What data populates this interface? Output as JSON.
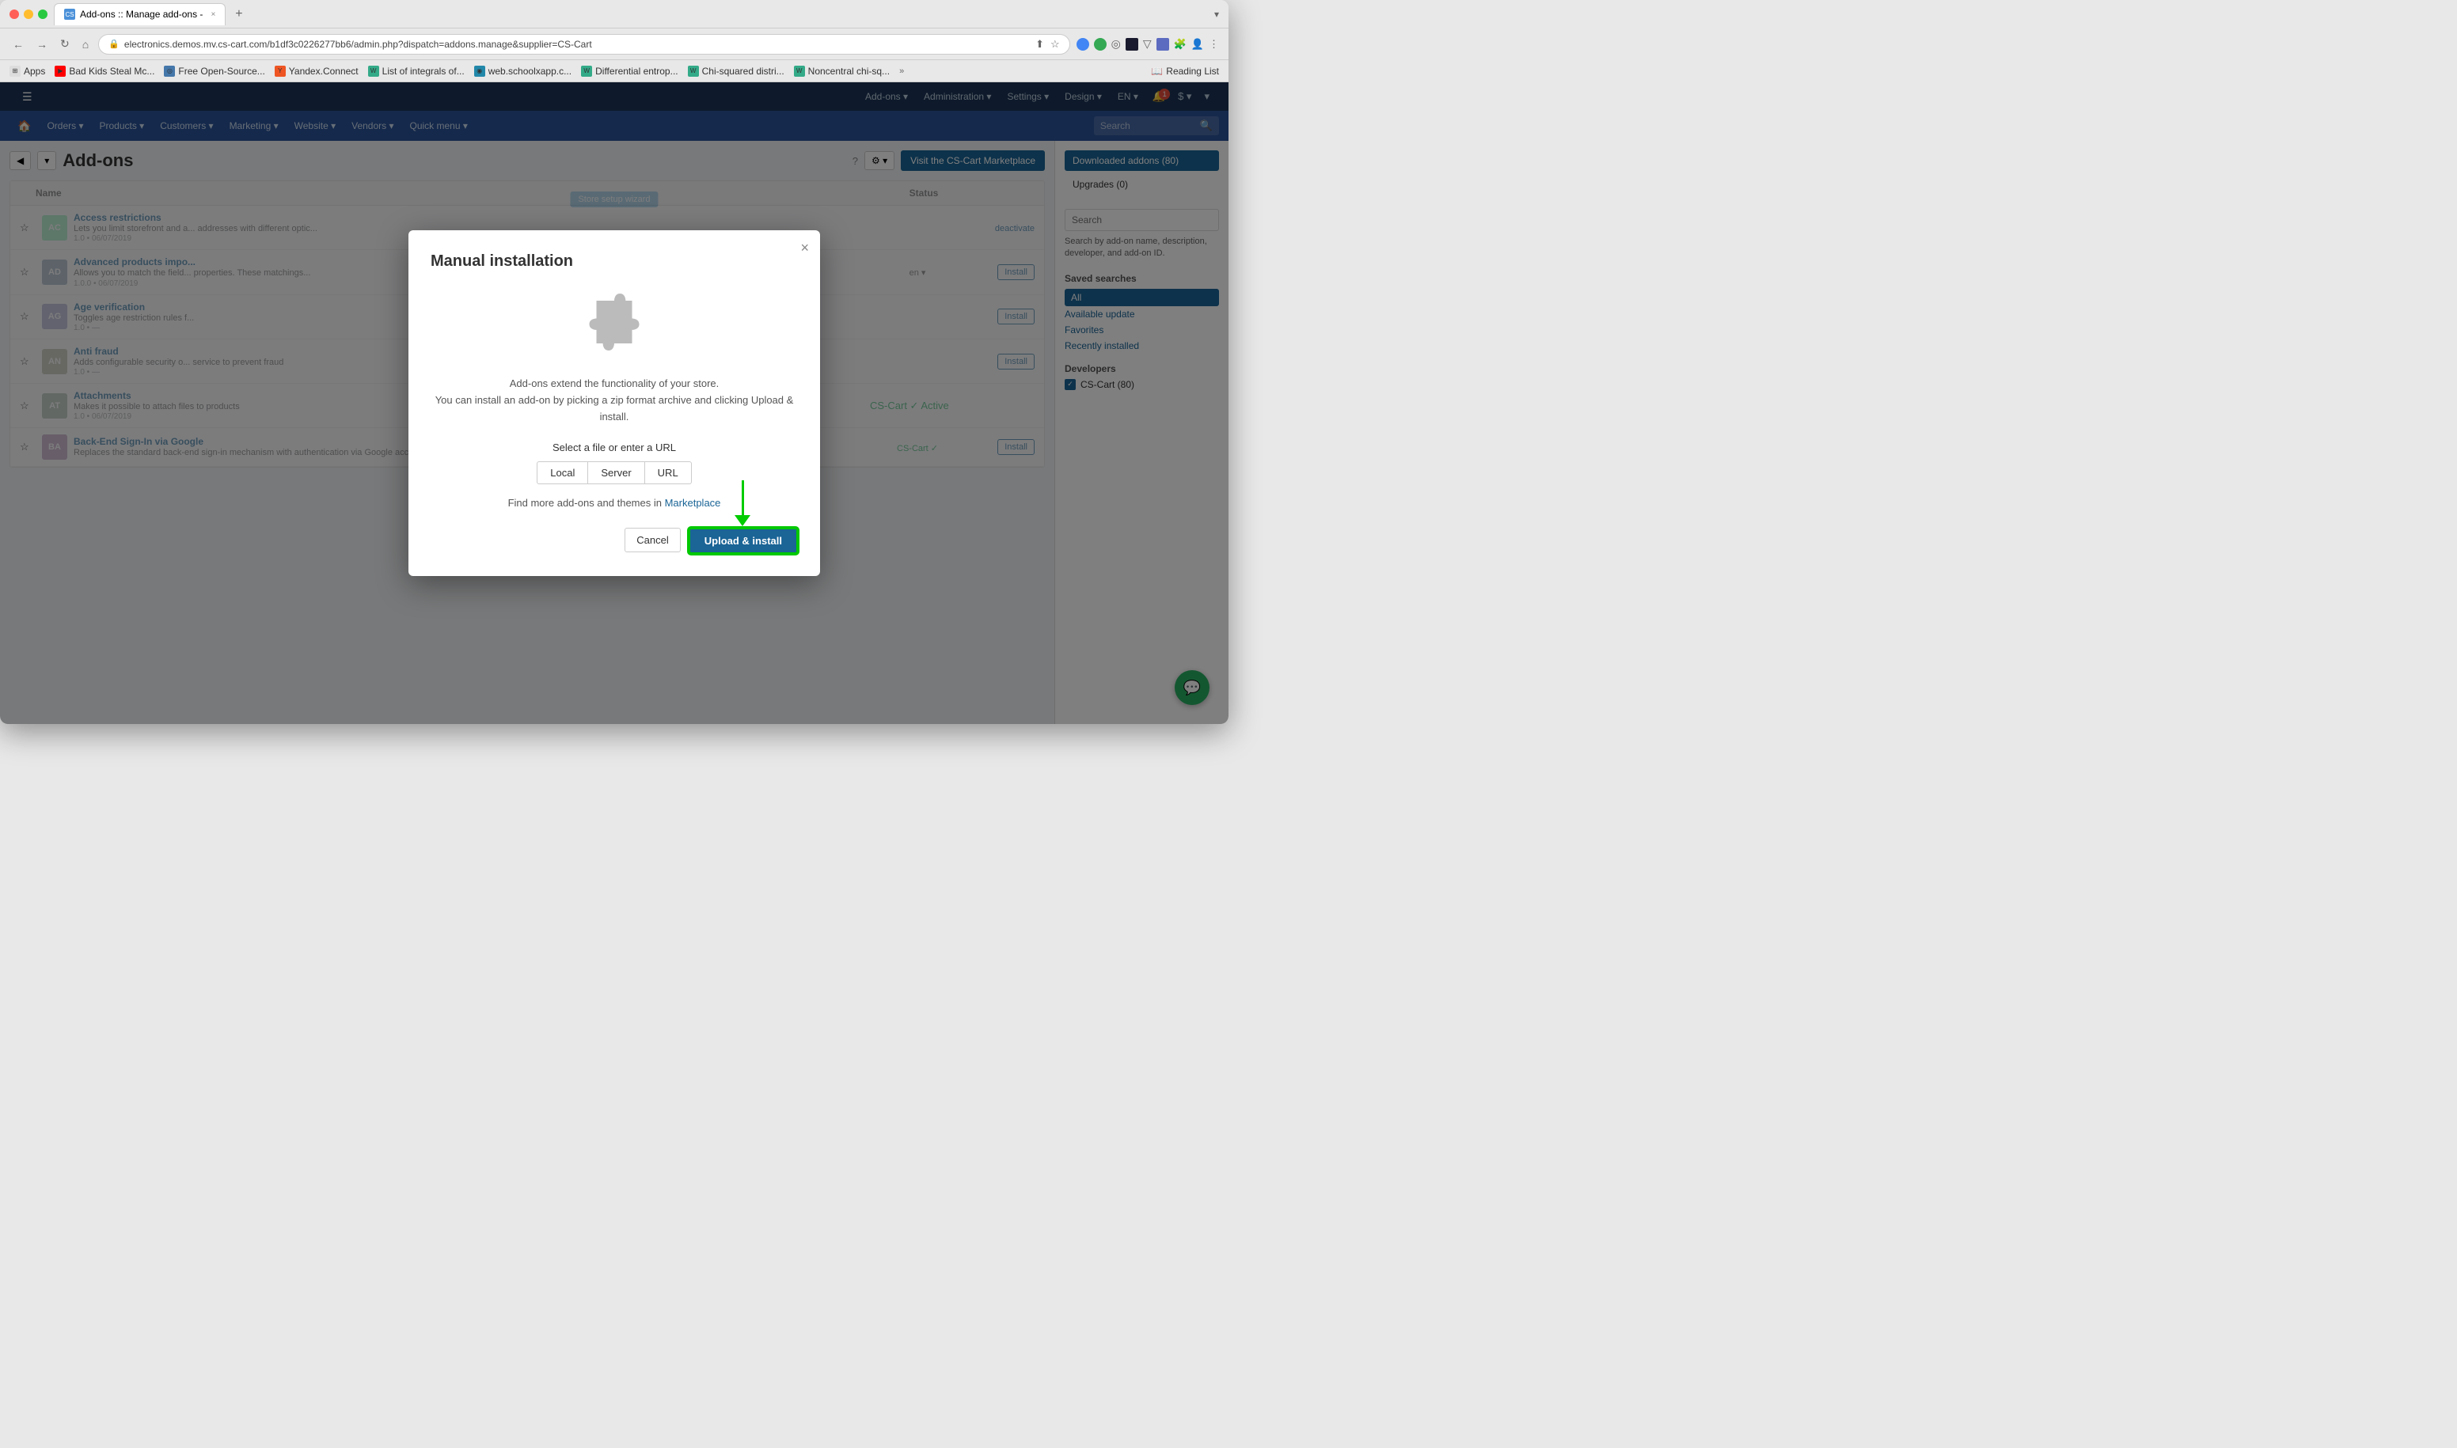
{
  "browser": {
    "tab_label": "Add-ons :: Manage add-ons -",
    "tab_close": "×",
    "tab_add": "+",
    "address": "electronics.demos.mv.cs-cart.com/b1df3c0226277bb6/admin.php?dispatch=addons.manage&supplier=CS-Cart",
    "collapse_icon": "▾",
    "bookmarks": [
      {
        "label": "Apps",
        "icon": "⊞"
      },
      {
        "label": "Bad Kids Steal Mc...",
        "icon": "▶"
      },
      {
        "label": "Free Open-Source...",
        "icon": "◎"
      },
      {
        "label": "Yandex.Connect",
        "icon": "Y"
      },
      {
        "label": "List of integrals of...",
        "icon": "W"
      },
      {
        "label": "web.schoolxapp.c...",
        "icon": "◉"
      },
      {
        "label": "Differential entrop...",
        "icon": "W"
      },
      {
        "label": "Chi-squared distri...",
        "icon": "W"
      },
      {
        "label": "Noncentral chi-sq...",
        "icon": "W"
      },
      {
        "label": "»",
        "icon": ""
      }
    ],
    "reading_list": "Reading List"
  },
  "topnav": {
    "setup_wizard": "Store setup wizard",
    "items": [
      "Add-ons ▾",
      "Administration ▾",
      "Settings ▾",
      "Design ▾",
      "EN ▾"
    ],
    "notification_count": "1",
    "currency": "$ ▾",
    "user": "▾"
  },
  "subnav": {
    "items": [
      "Orders ▾",
      "Products ▾",
      "Customers ▾",
      "Marketing ▾",
      "Website ▾",
      "Vendors ▾"
    ],
    "quick_menu": "Quick menu ▾",
    "search_placeholder": "Search"
  },
  "page": {
    "title": "Add-ons",
    "back_btn": "◀",
    "marketplace_btn": "Visit the CS-Cart Marketplace",
    "table": {
      "col_name": "Name",
      "col_status": "Status",
      "rows": [
        {
          "initials": "AC",
          "name": "Access restrictions",
          "desc": "Lets you limit storefront and a... addresses with different optic...",
          "meta": "1.0 • 06/07/2019",
          "status": "",
          "action": "deactivate",
          "bg": "addon-ac"
        },
        {
          "initials": "AD",
          "name": "Advanced products impo...",
          "desc": "Allows you to match the field... properties. These matchings... saved as presets for later use",
          "meta": "1.0.0 • 06/07/2019",
          "status": "en ▾",
          "action": "install",
          "bg": "addon-ad"
        },
        {
          "initials": "AG",
          "name": "Age verification",
          "desc": "Toggles age restriction rules f...",
          "meta": "1.0 • —",
          "status": "",
          "action": "install",
          "bg": "addon-ag"
        },
        {
          "initials": "AN",
          "name": "Anti fraud",
          "desc": "Adds configurable security o... service to prevent fraud",
          "meta": "1.0 • —",
          "status": "",
          "action": "install",
          "bg": "addon-an"
        },
        {
          "initials": "AT",
          "name": "Attachments",
          "desc": "Makes it possible to attach files to products",
          "meta": "1.0 • 06/07/2019",
          "status": "Active",
          "action": "active",
          "bg": "addon-at"
        },
        {
          "initials": "BA",
          "name": "Back-End Sign-In via Google",
          "desc": "Replaces the standard back-end sign-in mechanism with authentication via Google accounts.",
          "meta": "",
          "status": "CS-Cart ✓",
          "action": "install",
          "bg": "addon-ba"
        }
      ]
    }
  },
  "sidebar": {
    "downloaded_label": "Downloaded addons (80)",
    "upgrades_label": "Upgrades (0)",
    "search_placeholder": "Search",
    "search_desc": "Search by add-on name, description, developer, and add-on ID.",
    "saved_searches_title": "Saved searches",
    "saved_items": [
      {
        "label": "All",
        "active": true
      },
      {
        "label": "Available update",
        "active": false
      },
      {
        "label": "Favorites",
        "active": false
      },
      {
        "label": "Recently installed",
        "active": false
      }
    ],
    "developers_title": "Developers",
    "developers": [
      {
        "label": "CS-Cart (80)",
        "checked": true
      }
    ]
  },
  "modal": {
    "title": "Manual installation",
    "close": "×",
    "desc_line1": "Add-ons extend the functionality of your store.",
    "desc_line2": "You can install an add-on by picking a zip format archive and clicking Upload & install.",
    "file_label": "Select a file or enter a URL",
    "file_options": [
      "Local",
      "Server",
      "URL"
    ],
    "marketplace_text": "Find more add-ons and themes in",
    "marketplace_link": "Marketplace",
    "cancel_btn": "Cancel",
    "upload_btn": "Upload & install"
  },
  "chat": {
    "icon": "💬"
  }
}
